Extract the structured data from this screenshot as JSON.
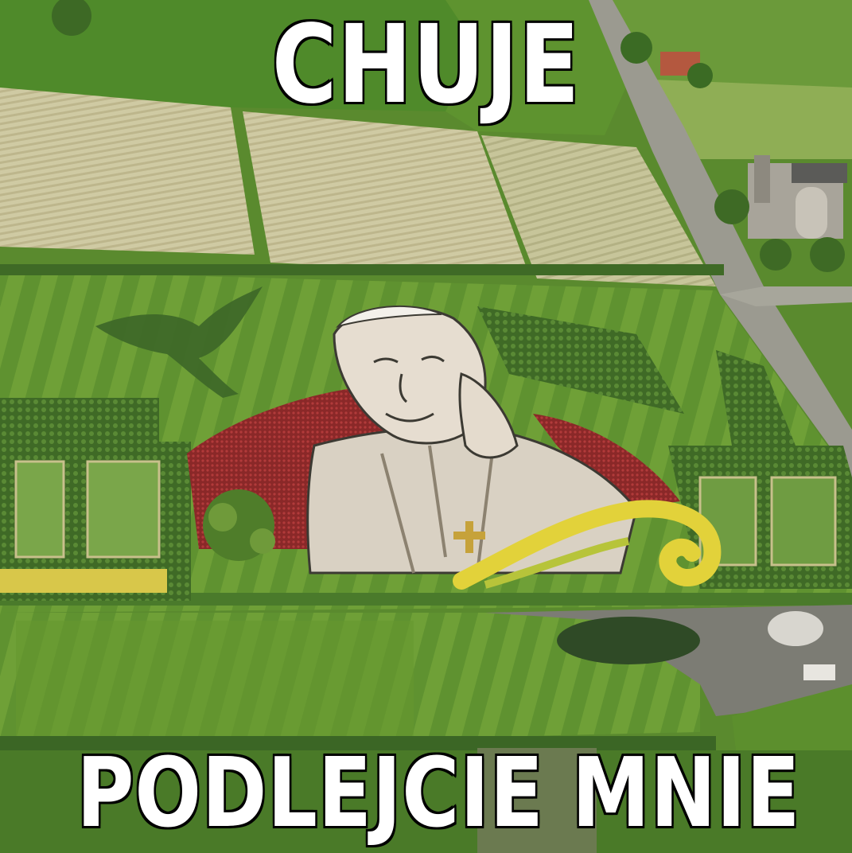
{
  "meme": {
    "top_text": "CHUJE",
    "bottom_text": "PODLEJCIE MNIE"
  },
  "photo": {
    "subject": "aerial-flower-garden-portrait",
    "colors": {
      "field_light": "#c9c49a",
      "field_green": "#5e8f2f",
      "lawn": "#6e9e36",
      "road": "#8a8a82",
      "cape_red": "#8f2a2a",
      "flower_yellow": "#e2d23a",
      "portrait_light": "#e8e2d4",
      "outline": "#3c3a33"
    }
  }
}
